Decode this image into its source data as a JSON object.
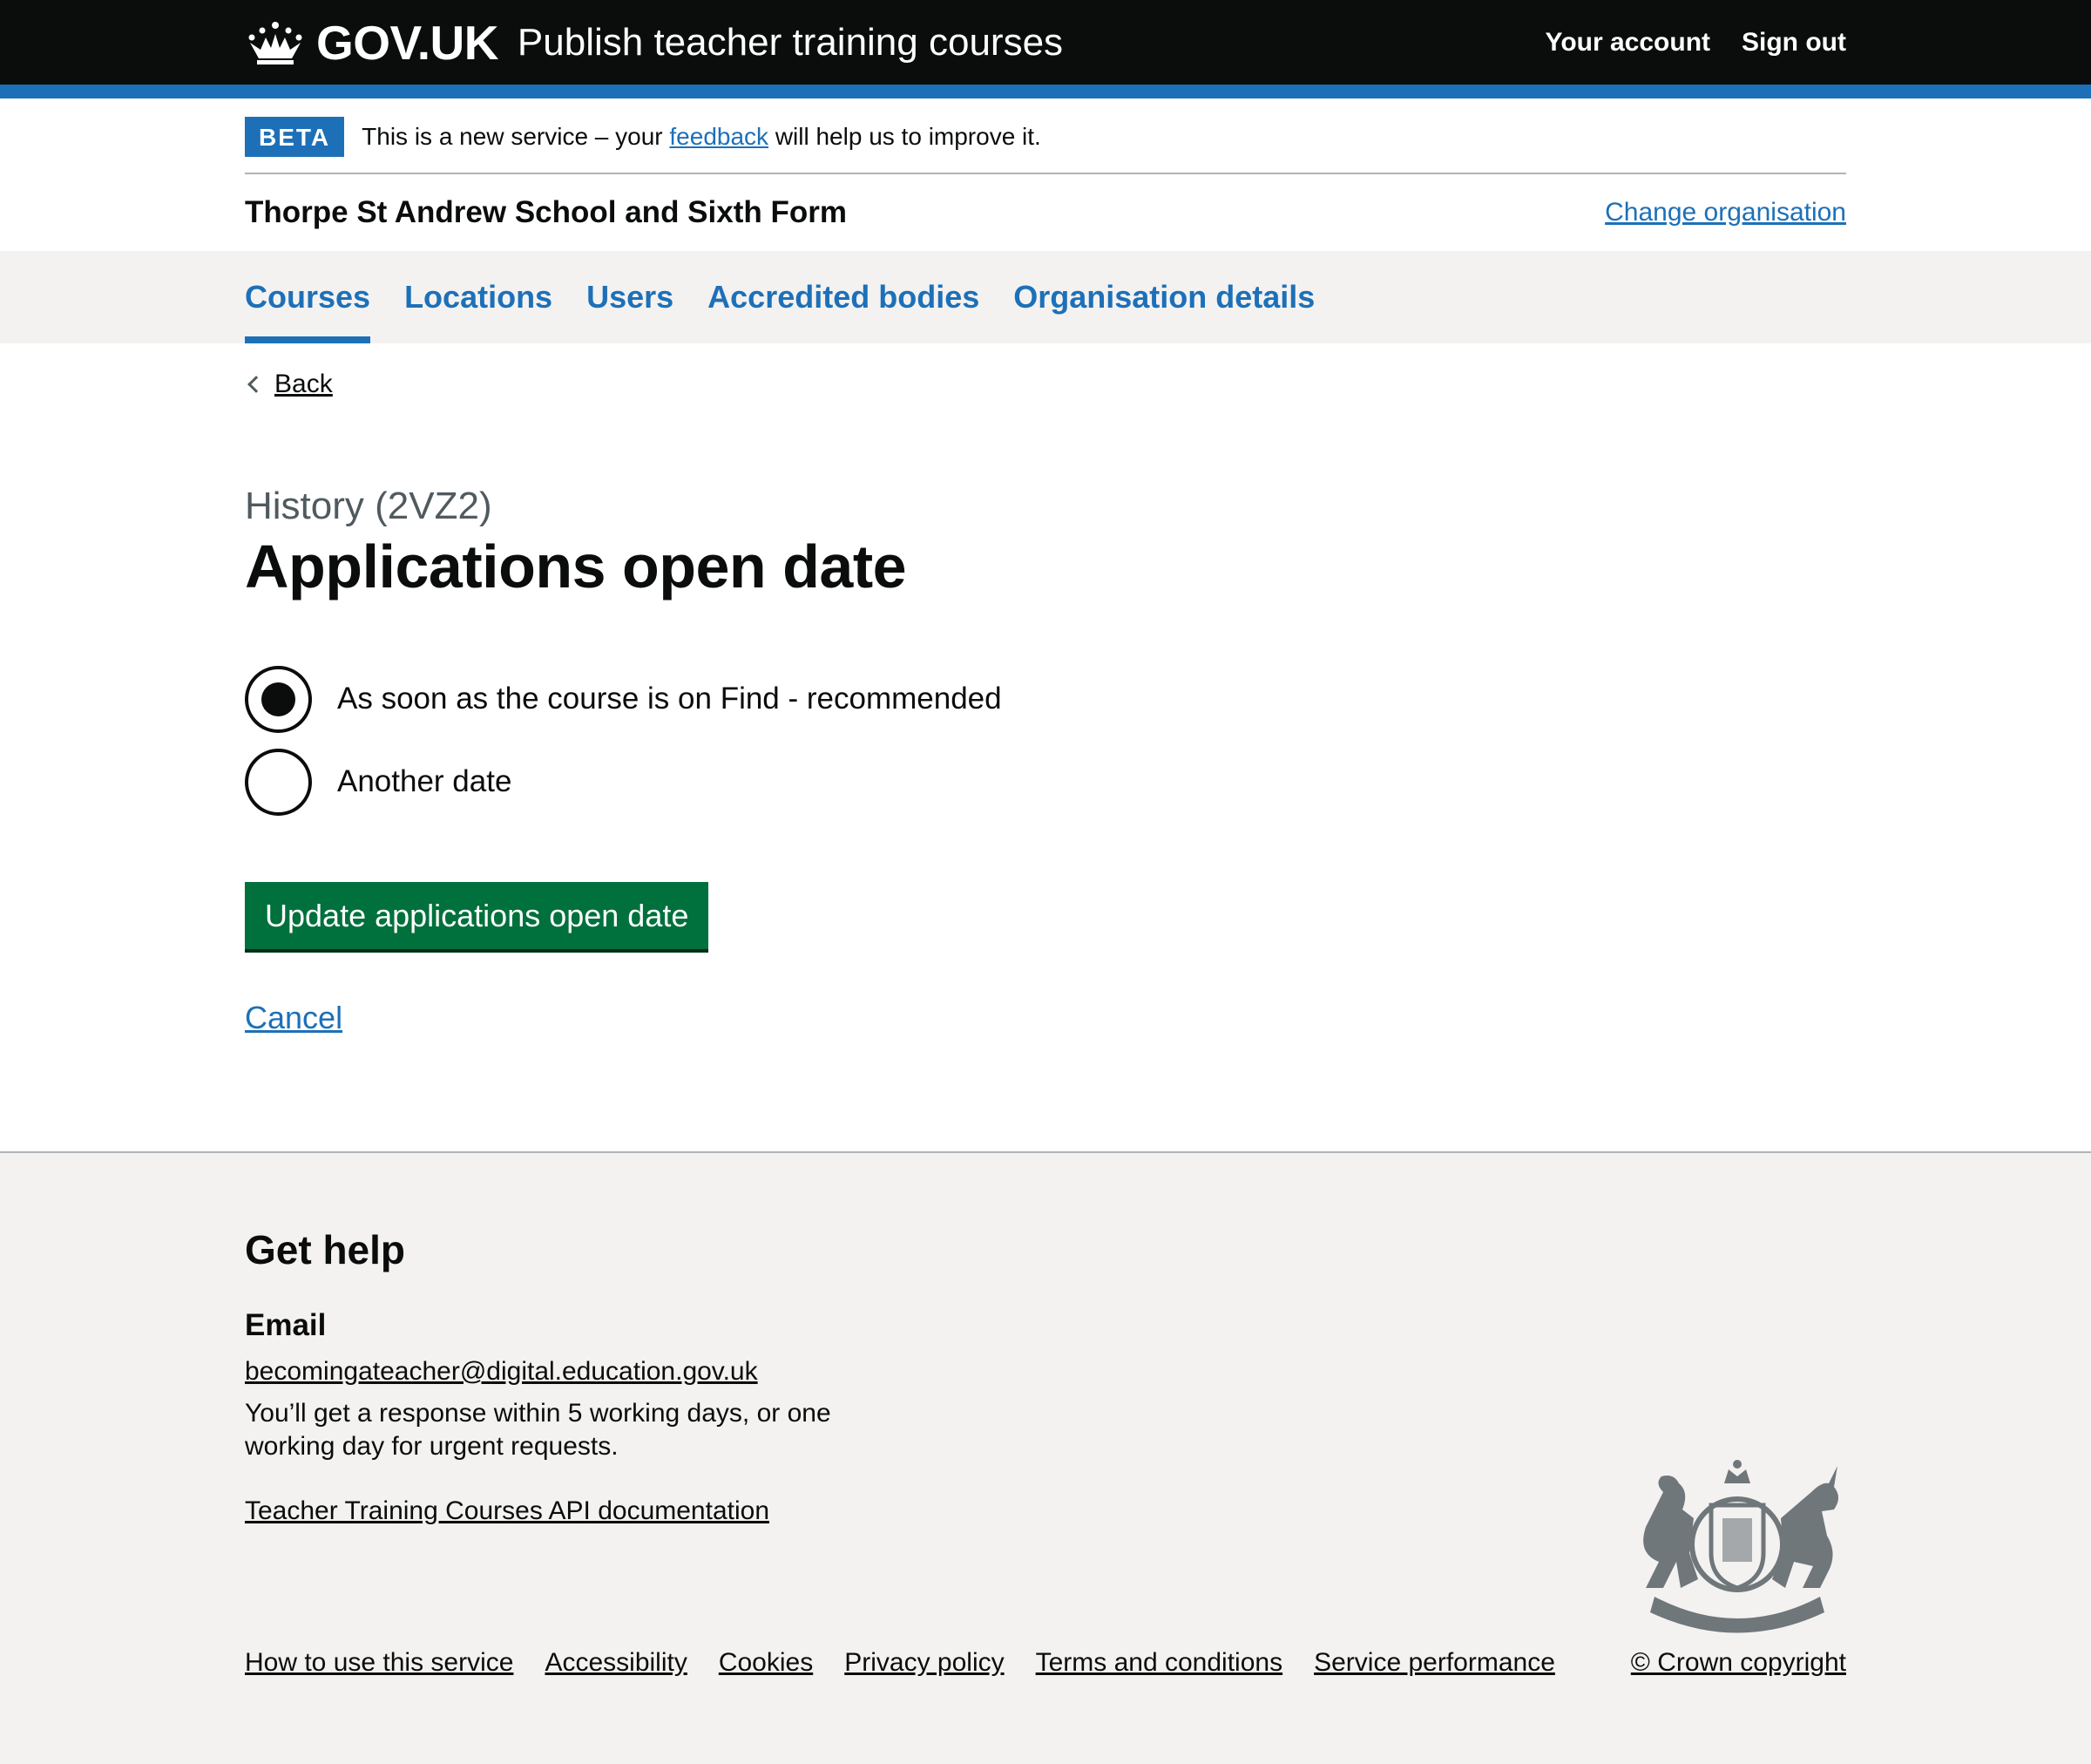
{
  "header": {
    "logo_text": "GOV.UK",
    "service_name": "Publish teacher training courses",
    "nav": [
      "Your account",
      "Sign out"
    ]
  },
  "phase_banner": {
    "tag": "BETA",
    "text_before": "This is a new service – your ",
    "link": "feedback",
    "text_after": " will help us to improve it."
  },
  "organisation": {
    "name": "Thorpe St Andrew School and Sixth Form",
    "change_link": "Change organisation"
  },
  "primary_nav": {
    "items": [
      "Courses",
      "Locations",
      "Users",
      "Accredited bodies",
      "Organisation details"
    ],
    "current": "Courses"
  },
  "main": {
    "back": "Back",
    "caption": "History (2VZ2)",
    "heading": "Applications open date",
    "radios": [
      {
        "label": "As soon as the course is on Find - recommended",
        "checked": true
      },
      {
        "label": "Another date",
        "checked": false
      }
    ],
    "submit": "Update applications open date",
    "cancel": "Cancel"
  },
  "footer": {
    "help_heading": "Get help",
    "email_heading": "Email",
    "email": "becomingateacher@digital.education.gov.uk",
    "response_text": "You’ll get a response within 5 working days, or one working day for urgent requests.",
    "api_link": "Teacher Training Courses API documentation",
    "links": [
      "How to use this service",
      "Accessibility",
      "Cookies",
      "Privacy policy",
      "Terms and conditions",
      "Service performance"
    ],
    "copyright": "© Crown copyright",
    "crest_icon": "royal-coat-of-arms-icon"
  },
  "colors": {
    "header_bg": "#0b0c0c",
    "brand_blue": "#1d70b8",
    "button_green": "#00703c",
    "footer_bg": "#f3f2f1",
    "secondary_text": "#505a5f"
  }
}
